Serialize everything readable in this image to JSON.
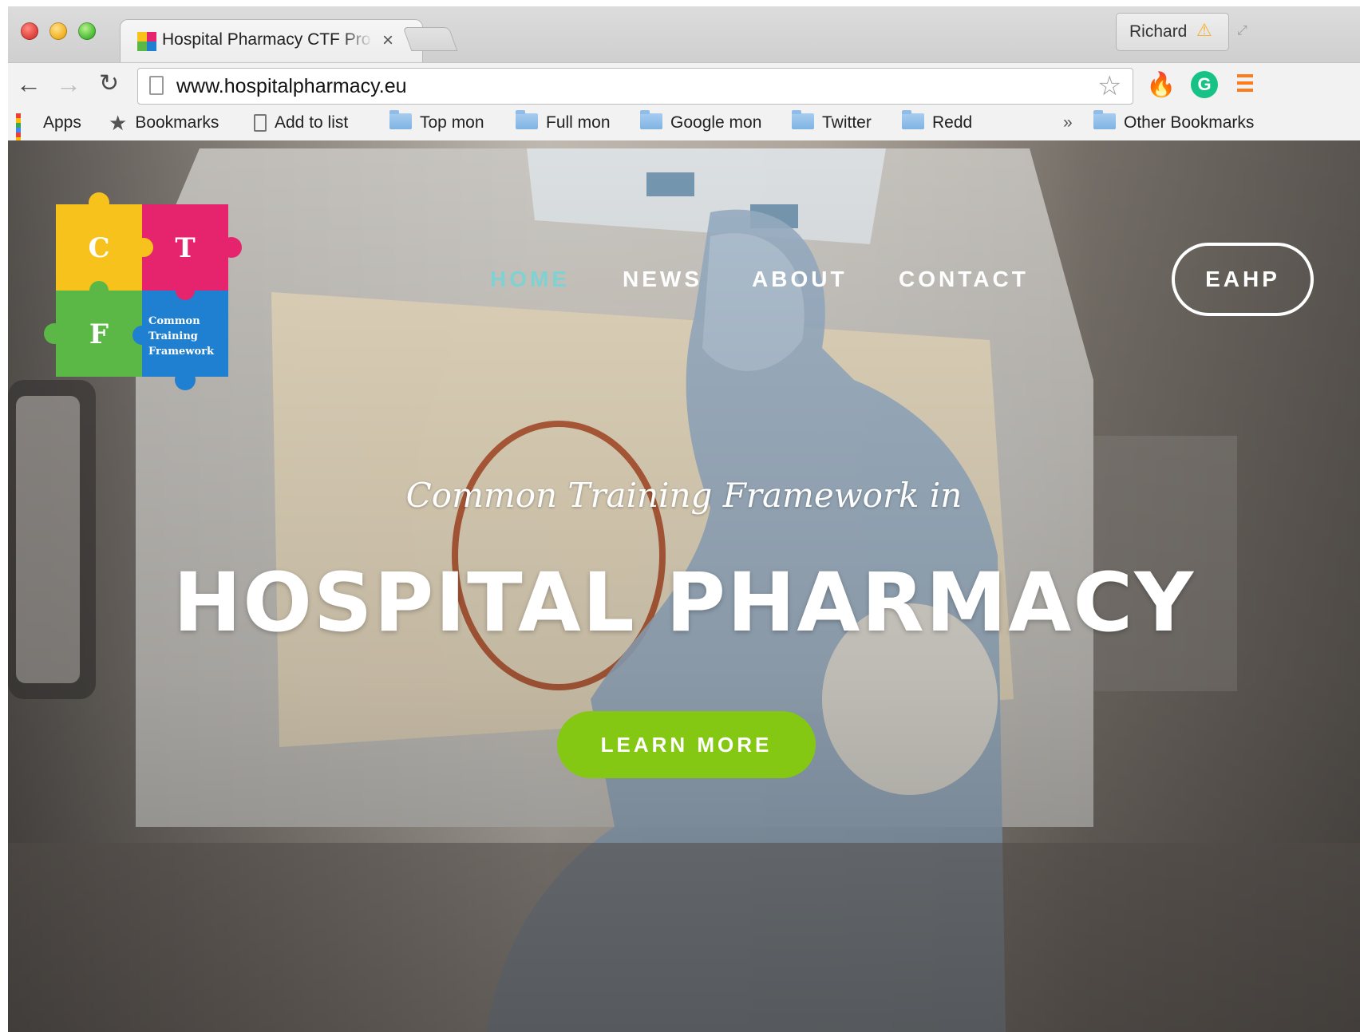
{
  "browser": {
    "tab": {
      "title": "Hospital Pharmacy CTF Pro"
    },
    "profile": {
      "name": "Richard"
    },
    "toolbar": {
      "url": "www.hospitalpharmacy.eu"
    },
    "bookmarks": [
      {
        "label": "Apps",
        "icon": "apps-grid-icon"
      },
      {
        "label": "Bookmarks",
        "icon": "star-icon"
      },
      {
        "label": "Add to list",
        "icon": "page-icon"
      },
      {
        "label": "Top mon",
        "icon": "folder-icon"
      },
      {
        "label": "Full mon",
        "icon": "folder-icon"
      },
      {
        "label": "Google mon",
        "icon": "folder-icon"
      },
      {
        "label": "Twitter",
        "icon": "folder-icon"
      },
      {
        "label": "Redd",
        "icon": "folder-icon"
      }
    ],
    "bookmarks_overflow": "»",
    "other_bookmarks": "Other Bookmarks"
  },
  "site": {
    "logo": {
      "letters": [
        "C",
        "T",
        "F"
      ],
      "text": [
        "Common",
        "Training",
        "Framework"
      ]
    },
    "nav": {
      "items": [
        {
          "label": "HOME",
          "active": true
        },
        {
          "label": "NEWS",
          "active": false
        },
        {
          "label": "ABOUT",
          "active": false
        },
        {
          "label": "CONTACT",
          "active": false
        }
      ],
      "eahp_label": "EAHP"
    },
    "hero": {
      "tagline": "Common Training Framework in",
      "headline": "HOSPITAL PHARMACY",
      "cta_label": "LEARN MORE"
    }
  },
  "colors": {
    "nav_active": "#7fd1d2",
    "cta": "#84c813",
    "logo_yellow": "#f7c21b",
    "logo_pink": "#e6246e",
    "logo_green": "#5cb846",
    "logo_blue": "#1f7fd0"
  }
}
